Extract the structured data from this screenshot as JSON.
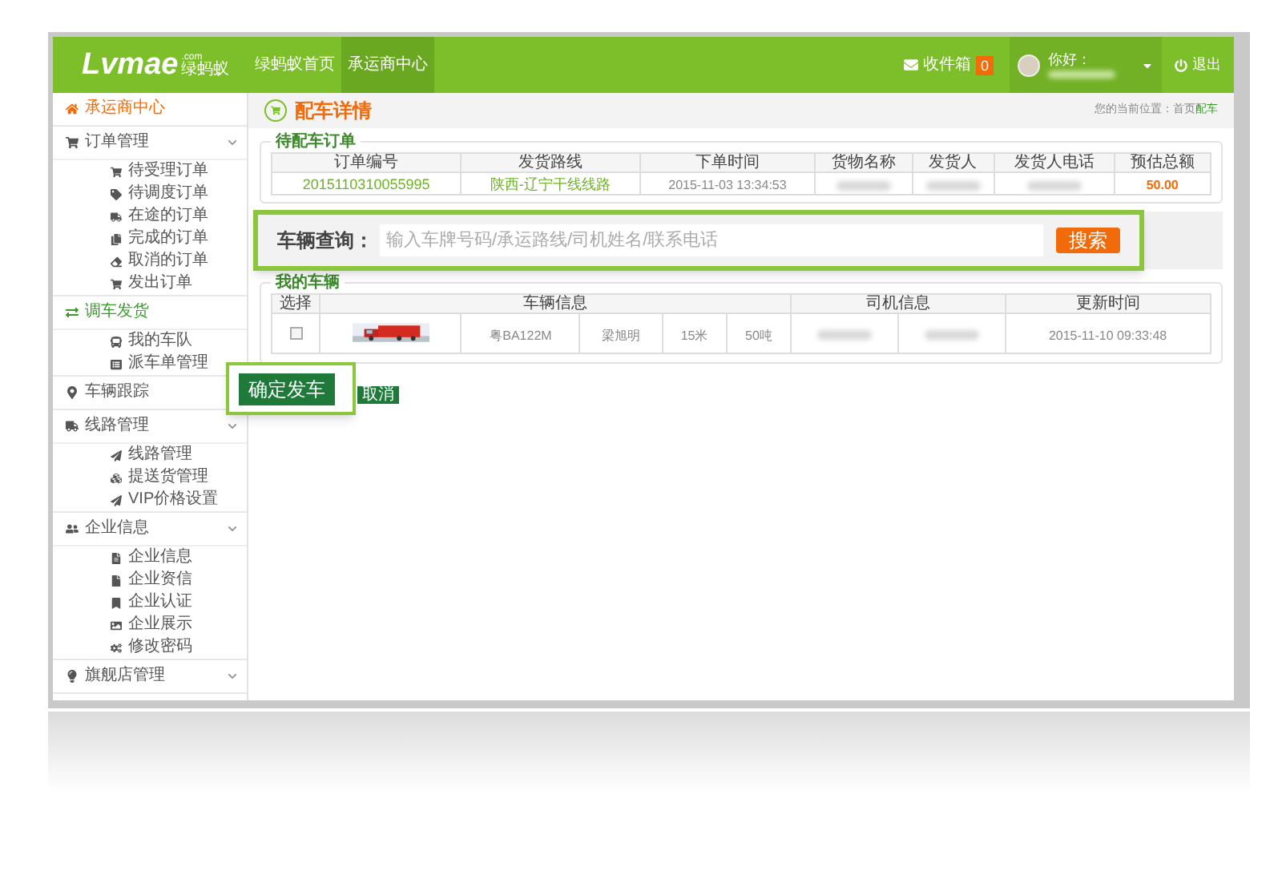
{
  "header": {
    "logo": "Lvmae",
    "logo_domain": ".com",
    "logo_cn": "绿蚂蚁",
    "nav": [
      {
        "label": "绿蚂蚁首页",
        "selected": false
      },
      {
        "label": "承运商中心",
        "selected": true
      }
    ],
    "inbox": {
      "label": "收件箱",
      "count": "0"
    },
    "greeting": "你好：",
    "logout": "退出"
  },
  "sidebar": [
    {
      "label": "承运商中心",
      "selected": true,
      "expandable": false
    },
    {
      "label": "订单管理",
      "selected": false,
      "expandable": true,
      "children": [
        {
          "label": "待受理订单"
        },
        {
          "label": "待调度订单"
        },
        {
          "label": "在途的订单"
        },
        {
          "label": "完成的订单"
        },
        {
          "label": "取消的订单"
        },
        {
          "label": "发出订单"
        }
      ]
    },
    {
      "label": "调车发货",
      "selected": false,
      "active": true,
      "expandable": false,
      "children": [
        {
          "label": "我的车队"
        },
        {
          "label": "派车单管理"
        }
      ]
    },
    {
      "label": "车辆跟踪",
      "selected": false
    },
    {
      "label": "线路管理",
      "selected": false,
      "expandable": true,
      "children": [
        {
          "label": "线路管理"
        },
        {
          "label": "提送货管理"
        },
        {
          "label": "VIP价格设置"
        }
      ]
    },
    {
      "label": "企业信息",
      "selected": false,
      "expandable": true,
      "children": [
        {
          "label": "企业信息"
        },
        {
          "label": "企业资信"
        },
        {
          "label": "企业认证"
        },
        {
          "label": "企业展示"
        },
        {
          "label": "修改密码"
        }
      ]
    },
    {
      "label": "旗舰店管理",
      "selected": false,
      "expandable": true
    }
  ],
  "page_title": "配车详情",
  "breadcrumb": {
    "prefix": "您的当前位置：首页",
    "current": "配车"
  },
  "orders": {
    "title": "待配车订单",
    "columns": [
      "订单编号",
      "发货路线",
      "下单时间",
      "货物名称",
      "发货人",
      "发货人电话",
      "预估总额"
    ],
    "rows": [
      [
        {
          "kind": "link",
          "text": "2015110310055995"
        },
        {
          "kind": "link",
          "text": "陕西-辽宁干线线路"
        },
        {
          "kind": "plain",
          "text": "2015-11-03 13:34:53"
        },
        {
          "kind": "blurred"
        },
        {
          "kind": "blurred"
        },
        {
          "kind": "blurred"
        },
        {
          "kind": "price",
          "text": "50.00"
        }
      ]
    ]
  },
  "search": {
    "label": "车辆查询：",
    "placeholder": "输入车牌号码/承运路线/司机姓名/联系电话",
    "button": "搜索"
  },
  "vehicles": {
    "title": "我的车辆",
    "columns": {
      "select": "选择",
      "vehicle": "车辆信息",
      "driver": "司机信息",
      "updated": "更新时间"
    },
    "rows": [
      {
        "checked": false,
        "vehicle": [
          {
            "kind": "picture"
          },
          {
            "kind": "plain",
            "text": "粤BA122M"
          },
          {
            "kind": "plain",
            "text": "梁旭明"
          },
          {
            "kind": "plain",
            "text": "15米"
          },
          {
            "kind": "plain",
            "text": "50吨"
          }
        ],
        "driver": [
          {
            "kind": "blurred"
          },
          {
            "kind": "blurred"
          }
        ],
        "updated": "2015-11-10 09:33:48"
      }
    ]
  },
  "confirm_button": "确定发车",
  "cancel_button": "取消"
}
